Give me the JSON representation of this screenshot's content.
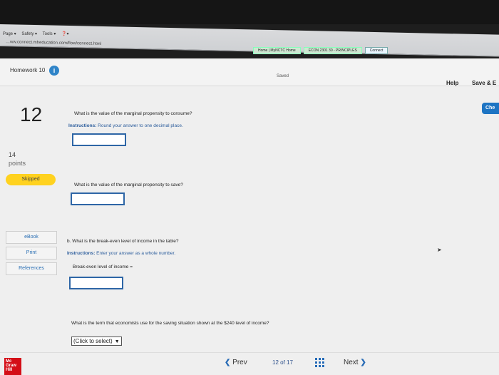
{
  "browser": {
    "url": "…ww.connect.mheducation.com/flow/connect.html",
    "commands": [
      "Page ▾",
      "Safety ▾",
      "Tools ▾",
      "❓▾"
    ],
    "tabs": [
      "Home | MyNCTC Home",
      "ECON 2301 30 - PRINCIPLES",
      "Connect"
    ]
  },
  "header": {
    "title": "Homework 10",
    "info_icon": "i",
    "saved": "Saved",
    "help": "Help",
    "save_exit": "Save & E"
  },
  "check_button": "Che",
  "question": {
    "number": "12",
    "points_value": "14",
    "points_label": "points",
    "status": "Skipped"
  },
  "sidebar": {
    "items": [
      "eBook",
      "Print",
      "References"
    ]
  },
  "parts": {
    "q1_text": "What is the value of the marginal propensity to consume?",
    "q1_instr_label": "Instructions:",
    "q1_instr_text": " Round your answer to one decimal place.",
    "q2_text": "What is the value of the marginal propensity to save?",
    "q3_text": "b. What is the break-even level of income in the table?",
    "q3_instr_label": "Instructions:",
    "q3_instr_text": " Enter your answer as a whole number.",
    "q3_field_label": "Break-even level of income =",
    "q4_text": "What is the term that economists use for the saving situation shown at the $240 level of income?",
    "q4_select": "(Click to select)"
  },
  "footer": {
    "logo": "Mc Graw Hill",
    "prev": "Prev",
    "page_current": "12",
    "page_of": "of",
    "page_total": "17",
    "next": "Next"
  }
}
